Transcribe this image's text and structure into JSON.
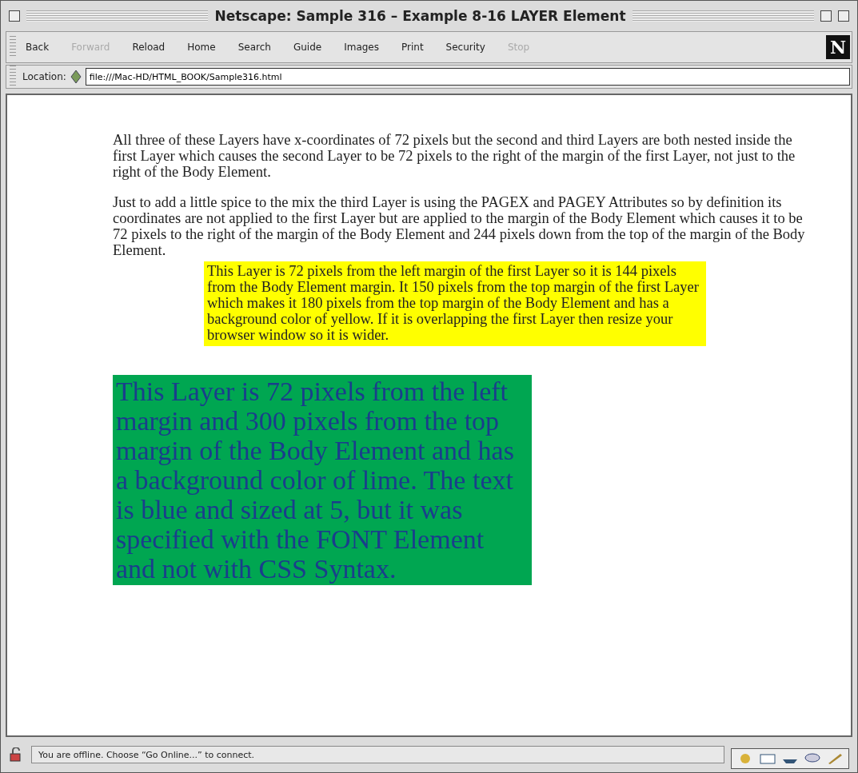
{
  "window": {
    "title": "Netscape: Sample 316 – Example 8-16 LAYER Element"
  },
  "toolbar": {
    "buttons": [
      {
        "label": "Back",
        "disabled": false
      },
      {
        "label": "Forward",
        "disabled": true
      },
      {
        "label": "Reload",
        "disabled": false
      },
      {
        "label": "Home",
        "disabled": false
      },
      {
        "label": "Search",
        "disabled": false
      },
      {
        "label": "Guide",
        "disabled": false
      },
      {
        "label": "Images",
        "disabled": false
      },
      {
        "label": "Print",
        "disabled": false
      },
      {
        "label": "Security",
        "disabled": false
      },
      {
        "label": "Stop",
        "disabled": true
      }
    ],
    "logo": "N"
  },
  "location": {
    "label": "Location:",
    "value": "file:///Mac-HD/HTML_BOOK/Sample316.html"
  },
  "content": {
    "paragraphs": [
      "All three of these Layers have x-coordinates of 72 pixels but the second and third Layers are both nested inside the first Layer which causes the second Layer to be 72 pixels to the right of the margin of the first Layer, not just to the right of the Body Element.",
      "Just to add a little spice to the mix the third Layer is using the PAGEX and PAGEY Attributes so by definition its coordinates are not applied to the first Layer but are applied to the margin of the Body Element which causes it to be 72 pixels to the right of the margin of the Body Element and 244 pixels down from the top of the margin of the Body Element."
    ],
    "layers": [
      {
        "kind": "yellow",
        "text": "This Layer is 72 pixels from the left margin of the first Layer so it is 144 pixels from the Body Element margin. It 150 pixels from the top margin of the first Layer which makes it 180 pixels from the top margin of the Body Element and has a background color of yellow. If it is overlapping the first Layer then resize your browser window so it is wider."
      },
      {
        "kind": "lime",
        "text": "This Layer is 72 pixels from the left margin and 300 pixels from the top margin of the Body Element and has a background color of lime. The text is blue and sized at 5, but it was specified with the FONT Element and not with CSS Syntax."
      }
    ]
  },
  "status_bar": {
    "text": "You are offline. Choose “Go Online...” to connect."
  }
}
